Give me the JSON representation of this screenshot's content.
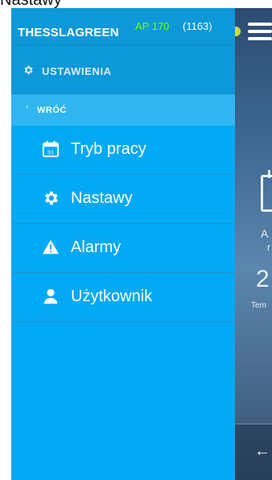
{
  "top_text": "Nastawy",
  "header": {
    "brand": "THESSLAGREEN",
    "device": "AP 170",
    "count": "(1163)"
  },
  "section": {
    "label": "USTAWIENIA",
    "icon": "gear-icon"
  },
  "back": {
    "label": "WRÓĆ",
    "icon": "chevron-left-icon"
  },
  "menu": [
    {
      "label": "Tryb pracy",
      "icon": "calendar-icon"
    },
    {
      "label": "Nastawy",
      "icon": "gear-icon"
    },
    {
      "label": "Alarmy",
      "icon": "warning-icon"
    },
    {
      "label": "Użytkownik",
      "icon": "user-icon"
    }
  ],
  "background": {
    "fragments": [
      "A",
      "r",
      "2",
      "Tem"
    ],
    "back_icon": "arrow-left-icon"
  },
  "colors": {
    "drawer": "#03a9f4",
    "header": "#0d98d8",
    "accent_green": "#76ff03",
    "status_dot": "#cddc39"
  }
}
